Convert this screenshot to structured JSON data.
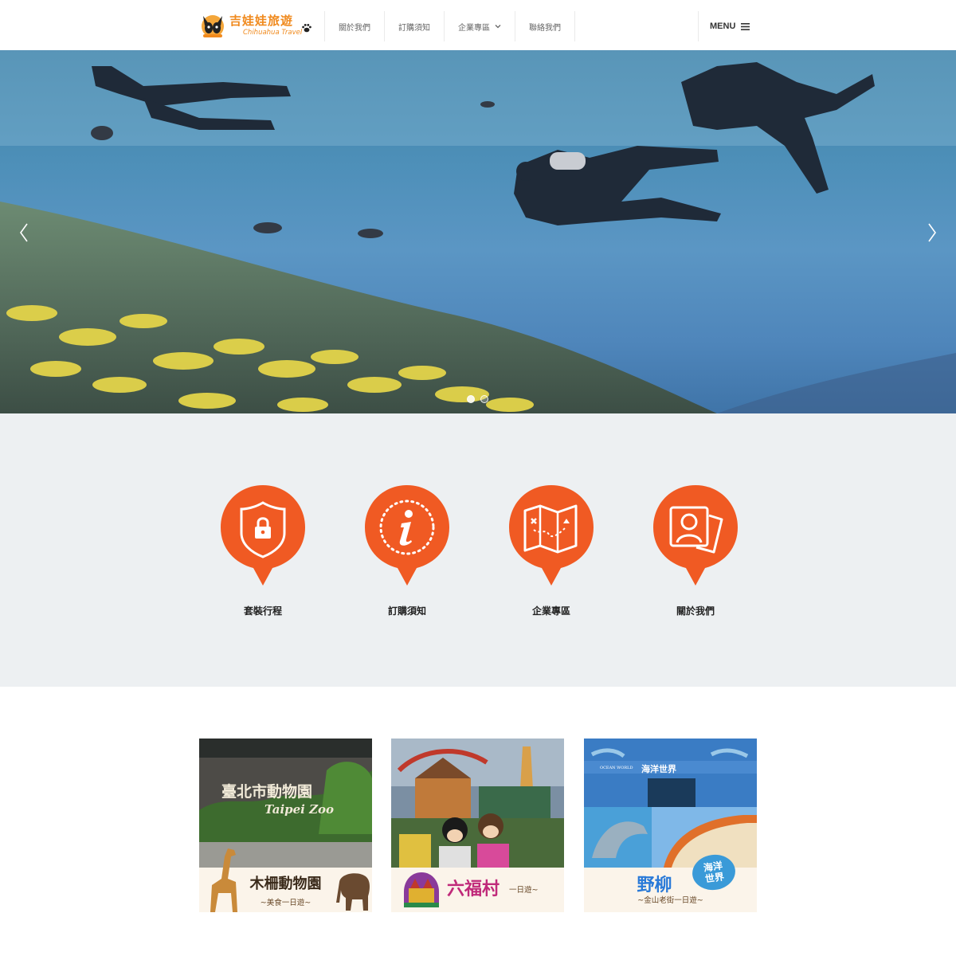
{
  "brand": {
    "name_cn": "吉娃娃旅遊",
    "name_en": "Chihuahua Travel"
  },
  "nav": {
    "items": [
      {
        "label": "關於我們"
      },
      {
        "label": "訂購須知"
      },
      {
        "label": "企業專區"
      },
      {
        "label": "聯絡我們"
      }
    ],
    "menu_label": "MENU"
  },
  "hero": {
    "prev_icon": "chevron-left-icon",
    "next_icon": "chevron-right-icon",
    "slide_count": 2,
    "active_slide": 1
  },
  "features": [
    {
      "label": "套裝行程",
      "icon": "shield-lock-icon"
    },
    {
      "label": "訂購須知",
      "icon": "info-icon"
    },
    {
      "label": "企業專區",
      "icon": "map-icon"
    },
    {
      "label": "關於我們",
      "icon": "profile-card-icon"
    }
  ],
  "tours": [
    {
      "sign_cn": "臺北市動物園",
      "sign_en": "Taipei Zoo",
      "title": "木柵動物園",
      "subtitle": "~美食一日遊~"
    },
    {
      "title": "六福村",
      "subtitle": "一日遊~"
    },
    {
      "sign_cn": "海洋世界",
      "sign_en": "OCEAN WORLD",
      "badge": "海洋\n世界",
      "title": "野柳",
      "subtitle": "~金山老街一日遊~"
    }
  ],
  "colors": {
    "accent": "#f05a23",
    "brand_orange": "#f08a1e",
    "band_bg": "#edf0f2"
  }
}
